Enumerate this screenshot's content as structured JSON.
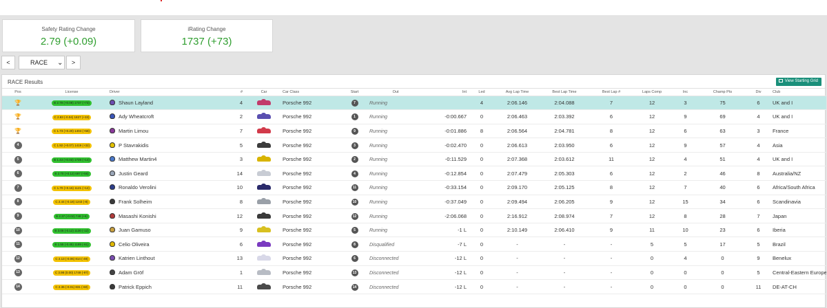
{
  "cards": {
    "safety": {
      "title": "Safety Rating Change",
      "value": "2.79 (+0.09)"
    },
    "irating": {
      "title": "iRating Change",
      "value": "1737 (+73)"
    }
  },
  "nav": {
    "prev": "<",
    "session": "RACE",
    "next": ">"
  },
  "panel": {
    "title": "RACE Results",
    "view_grid_label": "View Starting Grid"
  },
  "columns": [
    "Pos",
    "License",
    "Driver",
    "#",
    "Car",
    "Car Class",
    "Start",
    "Out",
    "Int",
    "Led",
    "Avg Lap Time",
    "Best Lap Time",
    "Best Lap #",
    "Laps Comp",
    "Inc",
    "Champ Pts",
    "Div",
    "Club"
  ],
  "rows": [
    {
      "pos": "1",
      "pos_icon": "trophy-gold",
      "license": "B 2.79 (+0.09) 1737 (+73)",
      "lic_class": "B",
      "helmet": "#6b4db0",
      "driver": "Shaun Layland",
      "num": "4",
      "car_color": "#c23b6b",
      "car_class": "Porsche 992",
      "start": "7",
      "out": "Running",
      "int": "",
      "led": "4",
      "avg": "2:06.146",
      "best": "2:04.088",
      "best_lap": "7",
      "laps": "12",
      "inc": "3",
      "champ": "75",
      "div": "6",
      "club": "UK and I"
    },
    {
      "pos": "2",
      "pos_icon": "trophy-silver",
      "license": "C 2.83 (-0.04) 1827 (+33)",
      "lic_class": "C",
      "helmet": "#3a56b8",
      "driver": "Ady Wheatcroft",
      "num": "2",
      "car_color": "#5a4fb0",
      "car_class": "Porsche 992",
      "start": "1",
      "out": "Running",
      "int": "-0:00.667",
      "led": "0",
      "avg": "2:06.463",
      "best": "2:03.392",
      "best_lap": "6",
      "laps": "12",
      "inc": "9",
      "champ": "69",
      "div": "4",
      "club": "UK and I"
    },
    {
      "pos": "3",
      "pos_icon": "trophy-bronze",
      "license": "C 1.73 (+0.20) 1404 (+58)",
      "lic_class": "C",
      "helmet": "#8a3a9a",
      "driver": "Martin Limou",
      "num": "7",
      "car_color": "#d23a4a",
      "car_class": "Porsche 992",
      "start": "9",
      "out": "Running",
      "int": "-0:01.886",
      "led": "8",
      "avg": "2:06.564",
      "best": "2:04.781",
      "best_lap": "8",
      "laps": "12",
      "inc": "6",
      "champ": "63",
      "div": "3",
      "club": "France"
    },
    {
      "pos": "4",
      "pos_icon": "",
      "license": "C 1.92 (+0.07) 1419 (+32)",
      "lic_class": "C",
      "helmet": "#e2c100",
      "driver": "P Stavrakidis",
      "num": "5",
      "car_color": "#3c3c3c",
      "car_class": "Porsche 992",
      "start": "3",
      "out": "Running",
      "int": "-0:02.470",
      "led": "0",
      "avg": "2:06.613",
      "best": "2:03.950",
      "best_lap": "6",
      "laps": "12",
      "inc": "9",
      "champ": "57",
      "div": "4",
      "club": "Asia"
    },
    {
      "pos": "5",
      "pos_icon": "",
      "license": "B 1.43 (+0.03) 1728 (+14)",
      "lic_class": "B",
      "helmet": "#4a78c8",
      "driver": "Matthew Martin4",
      "num": "3",
      "car_color": "#d8b400",
      "car_class": "Porsche 992",
      "start": "2",
      "out": "Running",
      "int": "-0:11.529",
      "led": "0",
      "avg": "2:07.368",
      "best": "2:03.612",
      "best_lap": "11",
      "laps": "12",
      "inc": "4",
      "champ": "51",
      "div": "4",
      "club": "UK and I"
    },
    {
      "pos": "6",
      "pos_icon": "",
      "license": "B 2.70 (+0.12) 697 (+56)",
      "lic_class": "B",
      "helmet": "#9aa6b8",
      "driver": "Justin Geard",
      "num": "14",
      "car_color": "#c8ccd4",
      "car_class": "Porsche 992",
      "start": "4",
      "out": "Running",
      "int": "-0:12.854",
      "led": "0",
      "avg": "2:07.479",
      "best": "2:05.303",
      "best_lap": "6",
      "laps": "12",
      "inc": "2",
      "champ": "46",
      "div": "8",
      "club": "Australia/NZ"
    },
    {
      "pos": "7",
      "pos_icon": "",
      "license": "C 1.70 (+0.16) 1121 (+12)",
      "lic_class": "C",
      "helmet": "#2c3e8a",
      "driver": "Ronaldo Verolini",
      "num": "10",
      "car_color": "#2a2a6a",
      "car_class": "Porsche 992",
      "start": "11",
      "out": "Running",
      "int": "-0:33.154",
      "led": "0",
      "avg": "2:09.170",
      "best": "2:05.125",
      "best_lap": "8",
      "laps": "12",
      "inc": "7",
      "champ": "40",
      "div": "6",
      "club": "Africa/South Africa"
    },
    {
      "pos": "8",
      "pos_icon": "",
      "license": "C 2.44 (-0.18) 1243 (-8)",
      "lic_class": "C",
      "helmet": "#3a3a3a",
      "driver": "Frank Solheim",
      "num": "8",
      "car_color": "#9aa0a8",
      "car_class": "Porsche 992",
      "start": "10",
      "out": "Running",
      "int": "-0:37.049",
      "led": "0",
      "avg": "2:09.494",
      "best": "2:06.205",
      "best_lap": "9",
      "laps": "12",
      "inc": "15",
      "champ": "34",
      "div": "6",
      "club": "Scandinavia"
    },
    {
      "pos": "9",
      "pos_icon": "",
      "license": "B 2.37 (-0.02) 748 (+6)",
      "lic_class": "B",
      "helmet": "#b03a3a",
      "driver": "Masashi Konishi",
      "num": "12",
      "car_color": "#3a3a3a",
      "car_class": "Porsche 992",
      "start": "12",
      "out": "Running",
      "int": "-2:06.068",
      "led": "0",
      "avg": "2:16.912",
      "best": "2:08.974",
      "best_lap": "7",
      "laps": "12",
      "inc": "8",
      "champ": "28",
      "div": "7",
      "club": "Japan"
    },
    {
      "pos": "10",
      "pos_icon": "",
      "license": "B 3.06 (-0.12) 1130 (-12)",
      "lic_class": "B",
      "helmet": "#c8a040",
      "driver": "Juan Gamuso",
      "num": "9",
      "car_color": "#d8c020",
      "car_class": "Porsche 992",
      "start": "5",
      "out": "Running",
      "int": "-1 L",
      "led": "0",
      "avg": "2:10.149",
      "best": "2:06.410",
      "best_lap": "9",
      "laps": "11",
      "inc": "10",
      "champ": "23",
      "div": "6",
      "club": "Iberia"
    },
    {
      "pos": "11",
      "pos_icon": "",
      "license": "B 1.55 (-0.45) 1189 (-61)",
      "lic_class": "B",
      "helmet": "#e0b800",
      "driver": "Celio Oliveira",
      "num": "6",
      "car_color": "#7a3ac0",
      "car_class": "Porsche 992",
      "start": "8",
      "out": "Disqualified",
      "int": "-7 L",
      "led": "0",
      "avg": "-",
      "best": "-",
      "best_lap": "-",
      "laps": "5",
      "inc": "5",
      "champ": "17",
      "div": "5",
      "club": "Brazil"
    },
    {
      "pos": "12",
      "pos_icon": "",
      "license": "C 2.13 (-0.06) 814 (-49)",
      "lic_class": "C",
      "helmet": "#7a4db0",
      "driver": "Katrien Linthout",
      "num": "13",
      "car_color": "#d8d8e8",
      "car_class": "Porsche 992",
      "start": "6",
      "out": "Disconnected",
      "int": "-12 L",
      "led": "0",
      "avg": "-",
      "best": "-",
      "best_lap": "-",
      "laps": "0",
      "inc": "4",
      "champ": "0",
      "div": "9",
      "club": "Benelux"
    },
    {
      "pos": "13",
      "pos_icon": "",
      "license": "C 3.98 (0.00) 1749 (-97)",
      "lic_class": "C",
      "helmet": "#444",
      "driver": "Adam Gröf",
      "num": "1",
      "car_color": "#b8bcc4",
      "car_class": "Porsche 992",
      "start": "13",
      "out": "Disconnected",
      "int": "-12 L",
      "led": "0",
      "avg": "-",
      "best": "-",
      "best_lap": "-",
      "laps": "0",
      "inc": "0",
      "champ": "0",
      "div": "5",
      "club": "Central-Eastern Europe"
    },
    {
      "pos": "14",
      "pos_icon": "",
      "license": "C 2.36 (-0.01) 831 (-60)",
      "lic_class": "C",
      "helmet": "#3a3a3a",
      "driver": "Patrick Eppich",
      "num": "11",
      "car_color": "#4a4a4a",
      "car_class": "Porsche 992",
      "start": "14",
      "out": "Disconnected",
      "int": "-12 L",
      "led": "0",
      "avg": "-",
      "best": "-",
      "best_lap": "-",
      "laps": "0",
      "inc": "0",
      "champ": "0",
      "div": "11",
      "club": "DE-AT-CH"
    }
  ],
  "trophy_colors": {
    "trophy-gold": "#e7b400",
    "trophy-silver": "#b9b9b9",
    "trophy-bronze": "#c9843a"
  }
}
